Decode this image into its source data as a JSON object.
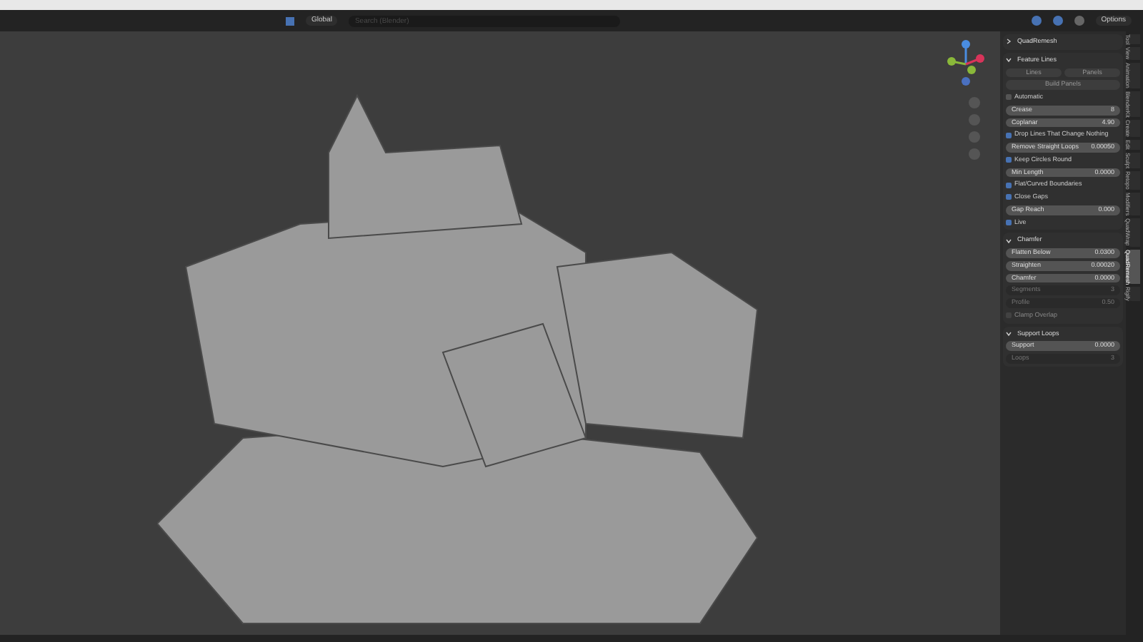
{
  "header": {
    "orientation": "Global",
    "search": {
      "placeholder": "Search (Blender)"
    },
    "options": "Options"
  },
  "panels": [
    {
      "title": "QuadRemesh",
      "expanded": false
    },
    {
      "title": "Feature Lines",
      "expanded": true,
      "rows": [
        {
          "kind": "pair",
          "left": "Lines",
          "right": "Panels"
        },
        {
          "kind": "button",
          "label": "Build Panels"
        },
        {
          "kind": "checkbox",
          "label": "Automatic",
          "checked": false,
          "disabled": false
        },
        {
          "kind": "field",
          "label": "Crease",
          "value": "8",
          "disabled": false
        },
        {
          "kind": "field",
          "label": "Coplanar",
          "value": "4.90",
          "disabled": false
        },
        {
          "kind": "checkbox",
          "label": "Drop Lines That Change Nothing",
          "checked": true,
          "disabled": false
        },
        {
          "kind": "field",
          "label": "Remove Straight Loops",
          "value": "0.00050",
          "disabled": false
        },
        {
          "kind": "checkbox",
          "label": "Keep Circles Round",
          "checked": true,
          "disabled": false
        },
        {
          "kind": "field",
          "label": "Min Length",
          "value": "0.0000",
          "disabled": false
        },
        {
          "kind": "checkbox",
          "label": "Flat/Curved Boundaries",
          "checked": true,
          "disabled": false
        },
        {
          "kind": "checkbox",
          "label": "Close Gaps",
          "checked": true,
          "disabled": false
        },
        {
          "kind": "field",
          "label": "Gap Reach",
          "value": "0.000",
          "disabled": false
        },
        {
          "kind": "checkbox",
          "label": "Live",
          "checked": true,
          "disabled": false
        }
      ]
    },
    {
      "title": "Chamfer",
      "expanded": true,
      "rows": [
        {
          "kind": "field",
          "label": "Flatten Below",
          "value": "0.0300",
          "disabled": false
        },
        {
          "kind": "field",
          "label": "Straighten",
          "value": "0.00020",
          "disabled": false
        },
        {
          "kind": "field",
          "label": "Chamfer",
          "value": "0.0000",
          "disabled": false
        },
        {
          "kind": "field",
          "label": "Segments",
          "value": "3",
          "disabled": true
        },
        {
          "kind": "field",
          "label": "Profile",
          "value": "0.50",
          "disabled": true
        },
        {
          "kind": "checkbox",
          "label": "Clamp Overlap",
          "checked": false,
          "disabled": true
        }
      ]
    },
    {
      "title": "Support Loops",
      "expanded": true,
      "rows": [
        {
          "kind": "field",
          "label": "Support",
          "value": "0.0000",
          "disabled": false
        },
        {
          "kind": "field",
          "label": "Loops",
          "value": "3",
          "disabled": true
        }
      ]
    }
  ],
  "side_tabs": [
    {
      "label": "Tool",
      "selected": false
    },
    {
      "label": "View",
      "selected": false
    },
    {
      "label": "Animation",
      "selected": false
    },
    {
      "label": "BlenderKit",
      "selected": false
    },
    {
      "label": "Create",
      "selected": false
    },
    {
      "label": "Edit",
      "selected": false
    },
    {
      "label": "Sculpt",
      "selected": false
    },
    {
      "label": "Retopo",
      "selected": false
    },
    {
      "label": "Modifiers",
      "selected": false
    },
    {
      "label": "QuadWrap",
      "selected": false
    },
    {
      "label": "QuadRemesh",
      "selected": true
    },
    {
      "label": "Rigify",
      "selected": false
    }
  ]
}
